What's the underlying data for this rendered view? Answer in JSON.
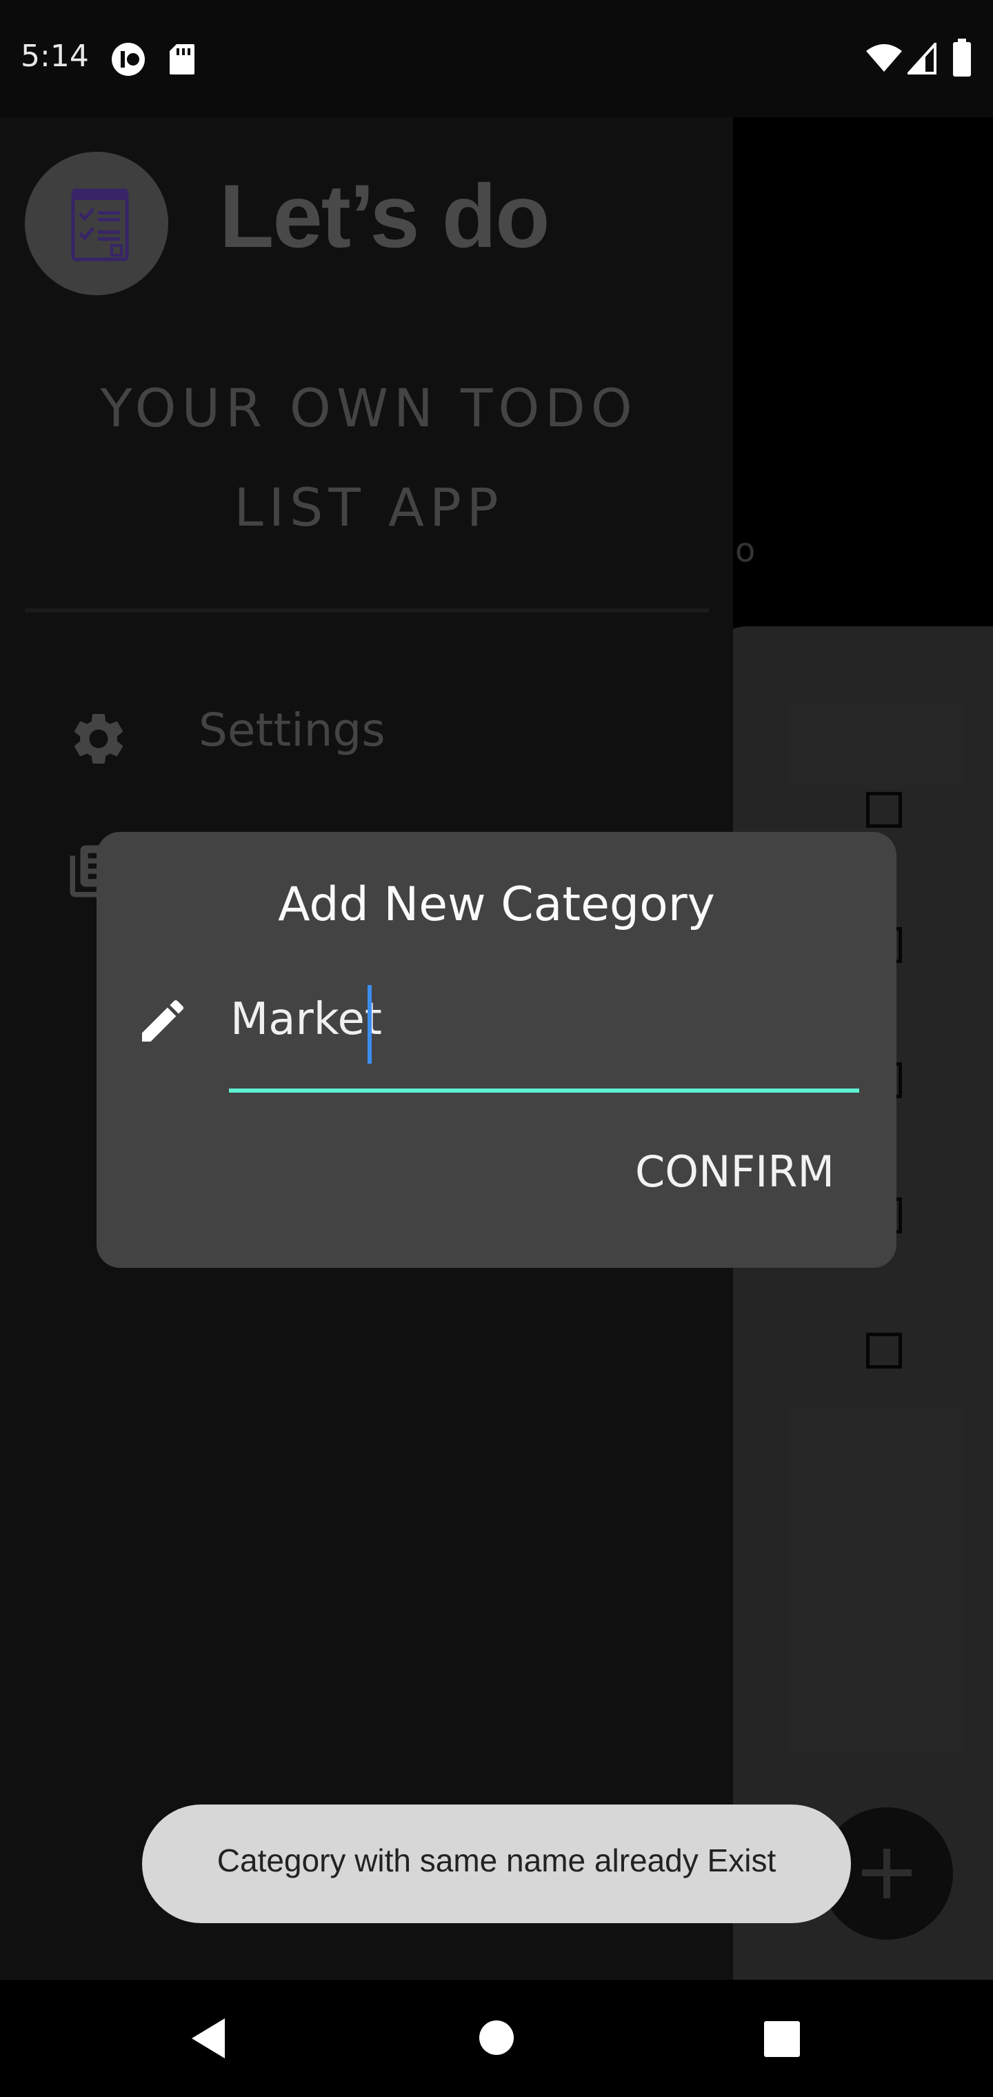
{
  "status_bar": {
    "time": "5:14",
    "icons": [
      "notification-app-icon",
      "sd-card-icon",
      "wifi-icon",
      "cell-signal-icon",
      "battery-icon"
    ]
  },
  "drawer": {
    "app_title": "Let’s do",
    "subtitle": "YOUR OWN TODO LIST APP",
    "logo_icon": "checklist-icon",
    "items": [
      {
        "label": "Settings",
        "icon": "gear-icon"
      },
      {
        "label": "",
        "icon": "library-icon"
      }
    ]
  },
  "background": {
    "partial_text": "o",
    "fab_icon": "plus-icon"
  },
  "dialog": {
    "title": "Add New Category",
    "input_value": "Market",
    "input_icon": "pencil-icon",
    "confirm_label": "CONFIRM"
  },
  "toast": {
    "message": "Category with same name already Exist"
  },
  "nav_bar": {
    "buttons": [
      "back-icon",
      "home-icon",
      "recents-icon"
    ]
  },
  "colors": {
    "accent_underline": "#5ff0d4",
    "caret": "#3b8ef0",
    "dialog_bg": "#434343",
    "toast_bg": "#d7d7d7"
  }
}
